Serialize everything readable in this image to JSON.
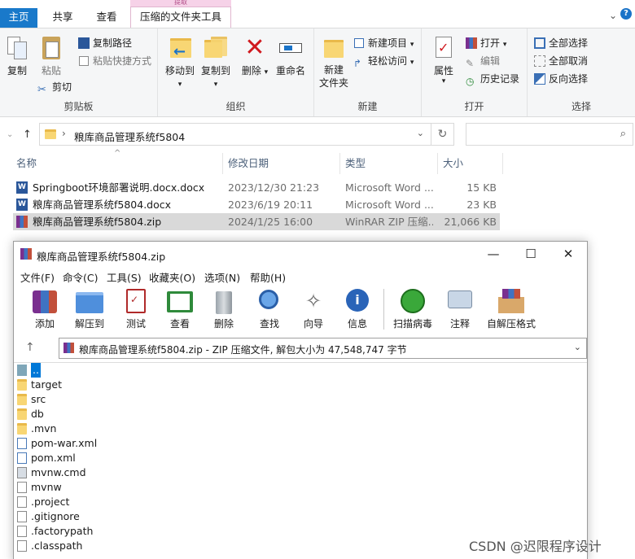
{
  "ribbon_tabs": {
    "home": "主页",
    "share": "共享",
    "view": "查看",
    "context_header": "提取",
    "context_tab": "压缩的文件夹工具"
  },
  "ribbon": {
    "clipboard": {
      "label": "剪贴板",
      "copy": "复制",
      "paste": "粘贴",
      "copy_path": "复制路径",
      "paste_shortcut": "粘贴快捷方式",
      "cut": "剪切"
    },
    "organize": {
      "label": "组织",
      "move_to": "移动到",
      "copy_to": "复制到",
      "delete": "删除",
      "rename": "重命名"
    },
    "new": {
      "label": "新建",
      "new_folder": "新建\n文件夹",
      "new_item": "新建项目",
      "easy_access": "轻松访问"
    },
    "open": {
      "label": "打开",
      "properties": "属性",
      "open": "打开",
      "edit": "编辑",
      "history": "历史记录"
    },
    "select": {
      "label": "选择",
      "select_all": "全部选择",
      "select_none": "全部取消",
      "invert": "反向选择"
    }
  },
  "address": {
    "path": "粮库商品管理系统f5804"
  },
  "columns": {
    "name": "名称",
    "date": "修改日期",
    "type": "类型",
    "size": "大小"
  },
  "files": [
    {
      "name": "Springboot环境部署说明.docx.docx",
      "date": "2023/12/30 21:23",
      "type": "Microsoft Word ...",
      "size": "15 KB",
      "icon": "word-doc-icon"
    },
    {
      "name": "粮库商品管理系统f5804.docx",
      "date": "2023/6/19 20:11",
      "type": "Microsoft Word ...",
      "size": "23 KB",
      "icon": "word-doc-icon"
    },
    {
      "name": "粮库商品管理系统f5804.zip",
      "date": "2024/1/25 16:00",
      "type": "WinRAR ZIP 压缩...",
      "size": "21,066 KB",
      "icon": "winrar-archive-icon"
    }
  ],
  "winrar": {
    "title": "粮库商品管理系统f5804.zip",
    "menus": [
      "文件(F)",
      "命令(C)",
      "工具(S)",
      "收藏夹(O)",
      "选项(N)",
      "帮助(H)"
    ],
    "tools": [
      "添加",
      "解压到",
      "测试",
      "查看",
      "删除",
      "查找",
      "向导",
      "信息",
      "扫描病毒",
      "注释",
      "自解压格式"
    ],
    "path_text": "粮库商品管理系统f5804.zip - ZIP 压缩文件, 解包大小为 47,548,747 字节",
    "entries": [
      {
        "name": "..",
        "kind": "up"
      },
      {
        "name": "target",
        "kind": "folder"
      },
      {
        "name": "src",
        "kind": "folder"
      },
      {
        "name": "db",
        "kind": "folder"
      },
      {
        "name": ".mvn",
        "kind": "folder"
      },
      {
        "name": "pom-war.xml",
        "kind": "xml"
      },
      {
        "name": "pom.xml",
        "kind": "xml"
      },
      {
        "name": "mvnw.cmd",
        "kind": "cmd"
      },
      {
        "name": "mvnw",
        "kind": "file"
      },
      {
        "name": ".project",
        "kind": "file"
      },
      {
        "name": ".gitignore",
        "kind": "file"
      },
      {
        "name": ".factorypath",
        "kind": "file"
      },
      {
        "name": ".classpath",
        "kind": "file"
      }
    ]
  },
  "watermark": "CSDN @迟限程序设计",
  "colors": {
    "accent": "#1979ca",
    "selection": "#0078d7",
    "context_tab": "#f6d2e8"
  }
}
